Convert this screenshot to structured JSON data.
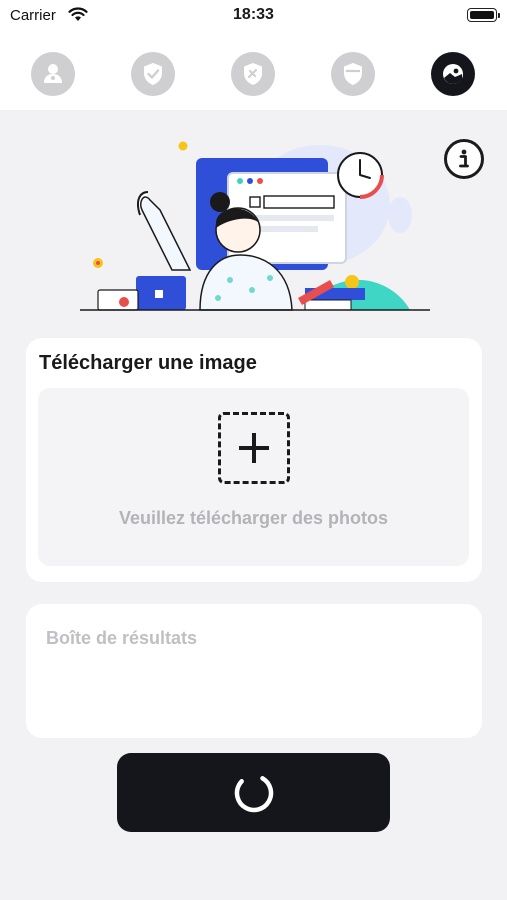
{
  "status_bar": {
    "carrier": "Carrier",
    "time": "18:33",
    "battery_level": 1.0
  },
  "tabs": [
    {
      "icon": "person-icon",
      "active": false
    },
    {
      "icon": "shield-check-icon",
      "active": false
    },
    {
      "icon": "tools-badge-icon",
      "active": false
    },
    {
      "icon": "shield-icon",
      "active": false
    },
    {
      "icon": "image-icon",
      "active": true
    }
  ],
  "hero": {
    "icon": "illustration-woman-waving"
  },
  "info_button": {
    "icon": "info-icon"
  },
  "upload": {
    "title": "Télécharger une image",
    "hint": "Veuillez télécharger des photos",
    "icon": "plus-icon"
  },
  "results": {
    "placeholder": "Boîte de résultats"
  },
  "action_button": {
    "icon": "loading-spinner-icon"
  },
  "colors": {
    "background": "#f2f2f4",
    "card": "#ffffff",
    "dark": "#14161c",
    "tab_inactive": "#cfcfd2",
    "placeholder_text": "#b3b3b8"
  }
}
